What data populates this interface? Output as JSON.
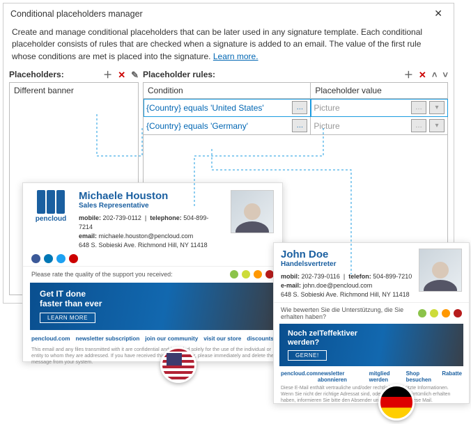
{
  "window": {
    "title": "Conditional placeholders manager",
    "description_a": "Create and manage conditional placeholders that can be later used in any signature template. Each conditional placeholder consists of rules that are checked when a signature is added to an email. The value of the first rule whose conditions are met is placed into the signature.",
    "learn_more": "Learn more."
  },
  "left": {
    "heading": "Placeholders:",
    "items": [
      "Different banner"
    ]
  },
  "right": {
    "heading": "Placeholder rules:",
    "cols": {
      "cond": "Condition",
      "val": "Placeholder value"
    },
    "rows": [
      {
        "cond": "{Country} equals 'United States'",
        "val": "Picture"
      },
      {
        "cond": "{Country} equals 'Germany'",
        "val": "Picture"
      }
    ]
  },
  "sig1": {
    "name": "Michaele Houston",
    "title": "Sales Representative",
    "mobile_lbl": "mobile:",
    "mobile": "202-739-0112",
    "tel_lbl": "telephone:",
    "tel": "504-899-7214",
    "email_lbl": "email:",
    "email": "michaele.houston@pencloud.com",
    "addr": "648 S. Sobieski Ave. Richmond Hill, NY 11418",
    "brand": "pencloud",
    "rate": "Please rate the quality of the support you received:",
    "banner_t1": "Get IT done",
    "banner_t2": "faster than ever",
    "cta": "LEARN MORE",
    "links": [
      "pencloud.com",
      "newsletter subscription",
      "join our community",
      "visit our store",
      "discounts"
    ],
    "disclaimer": "This email and any files transmitted with it are confidential and intended solely for the use of the individual or entity to whom they are addressed. If you have received this email in error, please immediately and delete the message from your system."
  },
  "sig2": {
    "name": "John Doe",
    "title": "Handelsvertreter",
    "mobile_lbl": "mobil:",
    "mobile": "202-739-0116",
    "tel_lbl": "telefon:",
    "tel": "504-899-7210",
    "email_lbl": "e-mail:",
    "email": "john.doe@pencloud.com",
    "addr": "648 S. Sobieski Ave. Richmond Hill, NY 11418",
    "rate": "Wie bewerten Sie die Unterstützung, die Sie erhalten haben?",
    "banner_t1": "Noch zeITeffektiver",
    "banner_t2": "werden?",
    "cta": "GERNE!",
    "links": [
      "pencloud.com",
      "newsletter abonnieren",
      "mitglied werden",
      "Shop besuchen",
      "Rabatte"
    ],
    "disclaimer": "Diese E-Mail enthält vertrauliche und/oder rechtlich geschützte Informationen. Wenn Sie nicht der richtige Adressat sind, oder diese E-Mail irrtümlich erhalten haben, informieren Sie bitte den Absender und löschen Sie diese Mail."
  }
}
